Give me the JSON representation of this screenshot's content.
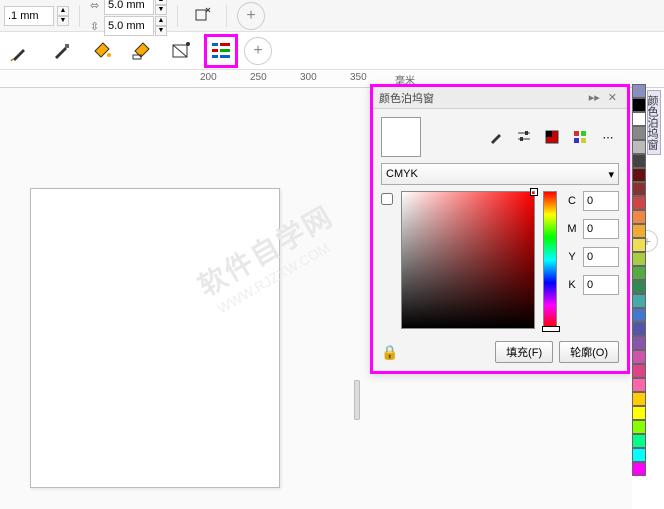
{
  "toolbar1": {
    "outline_value": ".1 mm",
    "dim_w": "5.0 mm",
    "dim_h": "5.0 mm"
  },
  "ruler": {
    "t1": "200",
    "t2": "250",
    "t3": "300",
    "t4": "350",
    "unit": "毫米"
  },
  "docker": {
    "title": "颜色泊坞窗",
    "model": "CMYK",
    "c_label": "C",
    "m_label": "M",
    "y_label": "Y",
    "k_label": "K",
    "c": "0",
    "m": "0",
    "y": "0",
    "k": "0",
    "fill_btn": "填充(F)",
    "outline_btn": "轮廓(O)"
  },
  "vtab": {
    "label": "颜色泊坞窗"
  },
  "palette": [
    "#8890c0",
    "#000000",
    "#ffffff",
    "#888888",
    "#bbbbbb",
    "#444444",
    "#661111",
    "#883333",
    "#cc4444",
    "#ee8844",
    "#eeaa33",
    "#eedd55",
    "#aacc44",
    "#55aa44",
    "#338855",
    "#44aaaa",
    "#4477cc",
    "#5555aa",
    "#8855aa",
    "#cc55aa",
    "#dd4488",
    "#ff66aa",
    "#ffcc00",
    "#ffff00",
    "#88ff00",
    "#00ff88",
    "#00ffff",
    "#ff00ff"
  ]
}
